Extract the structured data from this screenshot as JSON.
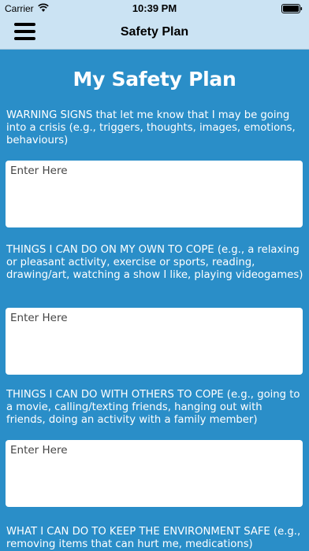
{
  "status_bar": {
    "carrier": "Carrier",
    "time": "10:39 PM"
  },
  "nav": {
    "title": "Safety Plan"
  },
  "page": {
    "title": "My Safety Plan"
  },
  "sections": [
    {
      "label": "WARNING SIGNS that let me know that I may be going into a crisis (e.g., triggers, thoughts, images, emotions, behaviours)",
      "placeholder": "Enter Here"
    },
    {
      "label": "THINGS I CAN DO ON MY OWN TO COPE (e.g., a relaxing or pleasant activity, exercise or sports, reading, drawing/art, watching a show I like, playing videogames)",
      "placeholder": "Enter Here"
    },
    {
      "label": "THINGS I CAN DO WITH OTHERS TO COPE (e.g., going to a movie, calling/texting friends, hanging out with friends, doing an activity with a family member)",
      "placeholder": "Enter Here"
    },
    {
      "label": "WHAT I CAN DO TO KEEP THE ENVIRONMENT SAFE (e.g., removing items that can hurt me, medications)",
      "placeholder": ""
    }
  ],
  "colors": {
    "background": "#2a8ec8",
    "header": "#cbe3f3",
    "text_on_background": "#ffffff"
  }
}
